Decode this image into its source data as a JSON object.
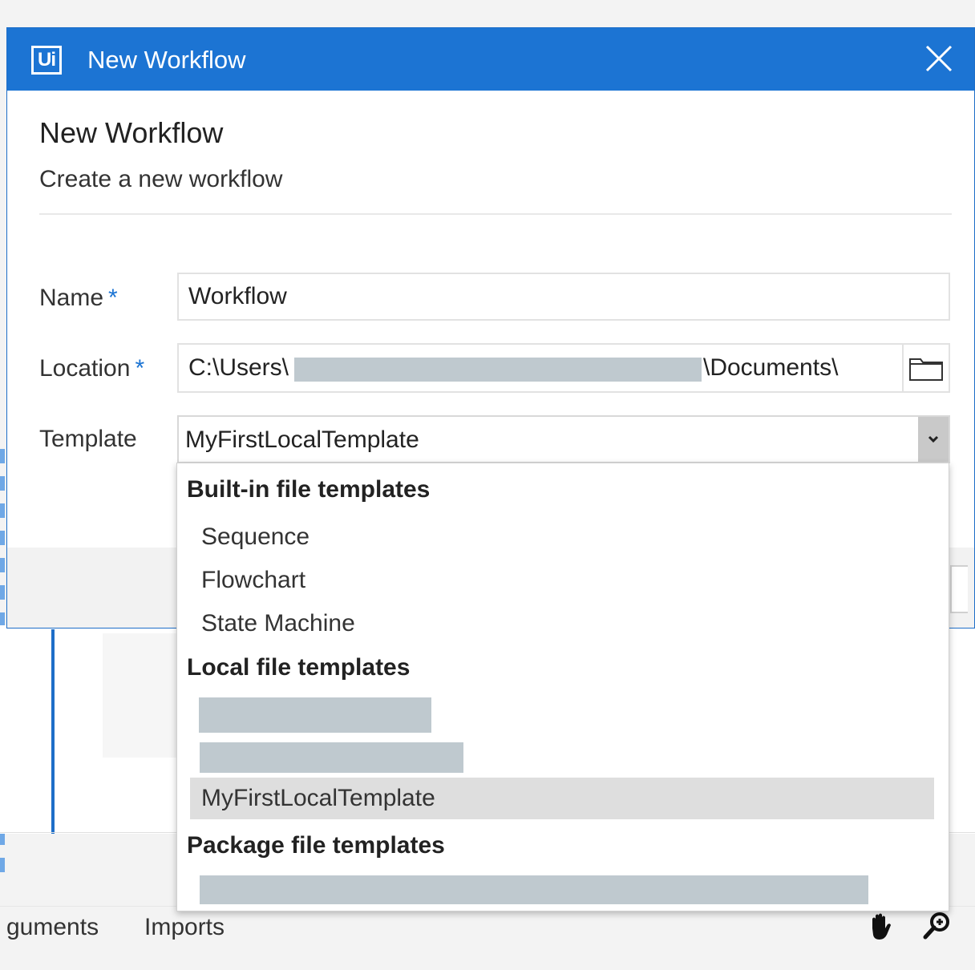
{
  "window": {
    "app_logo_text": "Ui",
    "title": "New Workflow"
  },
  "dialog": {
    "heading": "New Workflow",
    "subheading": "Create a new workflow"
  },
  "form": {
    "name": {
      "label": "Name",
      "required_marker": "*",
      "value": "Workflow"
    },
    "location": {
      "label": "Location",
      "required_marker": "*",
      "value_prefix": "C:\\Users\\",
      "value_suffix": "\\Documents\\"
    },
    "template": {
      "label": "Template",
      "selected": "MyFirstLocalTemplate"
    }
  },
  "template_dropdown": {
    "groups": [
      {
        "header": "Built-in file templates",
        "items": [
          "Sequence",
          "Flowchart",
          "State Machine"
        ]
      },
      {
        "header": "Local file templates",
        "items": [
          "MyFirstLocalTemplate"
        ]
      },
      {
        "header": "Package file templates",
        "items": []
      }
    ]
  },
  "background": {
    "tabs": [
      "guments",
      "Imports"
    ]
  },
  "icons": {
    "close": "close-icon",
    "browse": "folder-icon",
    "dropdown": "chevron-down-icon",
    "pan": "hand-icon",
    "zoom": "magnifier-icon"
  },
  "colors": {
    "accent": "#1c74d3",
    "selected_item": "#dedede",
    "redaction": "#bfc9cf"
  }
}
